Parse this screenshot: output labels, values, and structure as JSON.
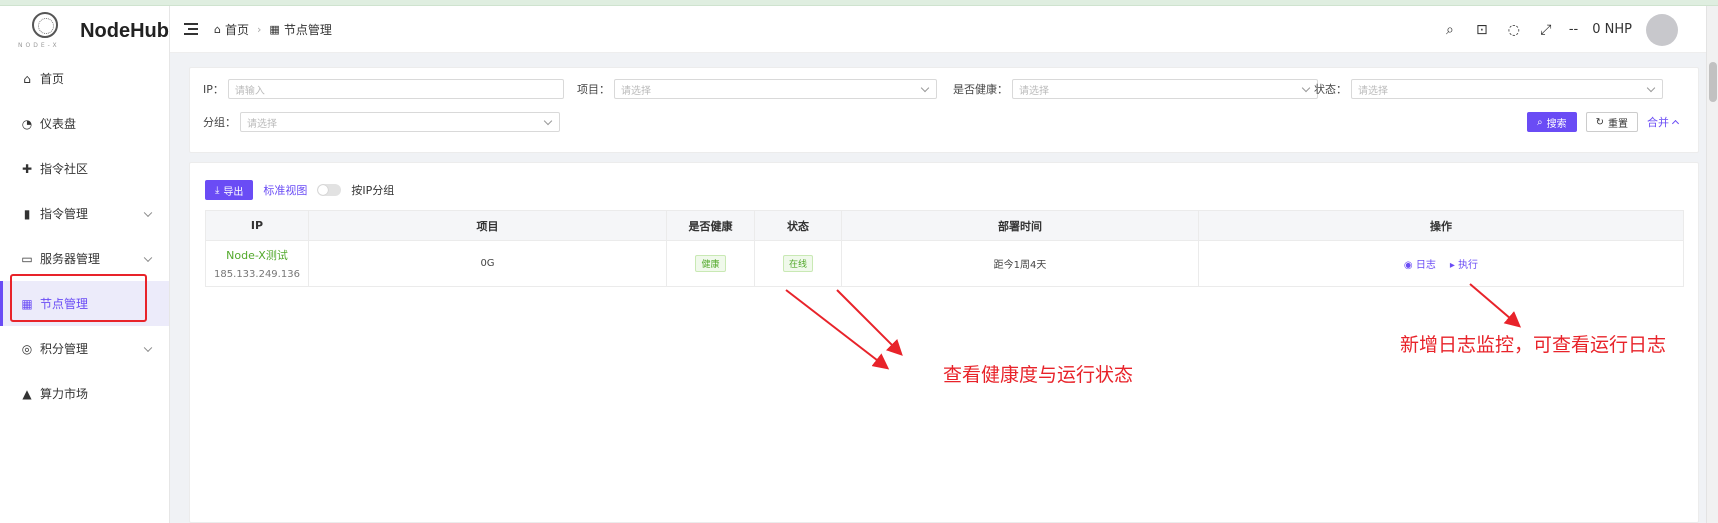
{
  "app": {
    "name": "NodeHub",
    "logo_sub": "NODE-X"
  },
  "sidebar": {
    "items": [
      {
        "label": "首页",
        "icon": "home-icon",
        "has_children": false,
        "active": false
      },
      {
        "label": "仪表盘",
        "icon": "dashboard-icon",
        "has_children": false,
        "active": false
      },
      {
        "label": "指令社区",
        "icon": "community-icon",
        "has_children": false,
        "active": false
      },
      {
        "label": "指令管理",
        "icon": "command-icon",
        "has_children": true,
        "active": false
      },
      {
        "label": "服务器管理",
        "icon": "server-icon",
        "has_children": true,
        "active": false
      },
      {
        "label": "节点管理",
        "icon": "grid-icon",
        "has_children": false,
        "active": true
      },
      {
        "label": "积分管理",
        "icon": "coins-icon",
        "has_children": true,
        "active": false
      },
      {
        "label": "算力市场",
        "icon": "shop-icon",
        "has_children": false,
        "active": false
      }
    ]
  },
  "header": {
    "breadcrumb": [
      "首页",
      "节点管理"
    ],
    "dash": "--",
    "balance": "0 NHP"
  },
  "filter": {
    "ip_label": "IP：",
    "ip_placeholder": "请输入",
    "project_label": "项目：",
    "project_placeholder": "请选择",
    "healthy_label": "是否健康：",
    "healthy_placeholder": "请选择",
    "status_label": "状态：",
    "status_placeholder": "请选择",
    "group_label": "分组：",
    "group_placeholder": "请选择",
    "search_btn": "搜索",
    "reset_btn": "重置",
    "collapse_btn": "合并"
  },
  "toolbar": {
    "export_btn": "导出",
    "view_link": "标准视图",
    "group_toggle_label": "按IP分组"
  },
  "table": {
    "columns": [
      "IP",
      "项目",
      "是否健康",
      "状态",
      "部署时间",
      "操作"
    ],
    "rows": [
      {
        "node_name": "Node-X测试",
        "ip": "185.133.249.136",
        "project": "0G",
        "healthy": "健康",
        "status": "在线",
        "deploy_time": "距今1周4天",
        "op_log": "日志",
        "op_exec": "执行"
      }
    ]
  },
  "annotations": {
    "health_note": "查看健康度与运行状态",
    "log_note": "新增日志监控，可查看运行日志"
  },
  "colors": {
    "accent": "#6a4cf5",
    "success": "#52a92b",
    "annotation": "#e8232a"
  }
}
